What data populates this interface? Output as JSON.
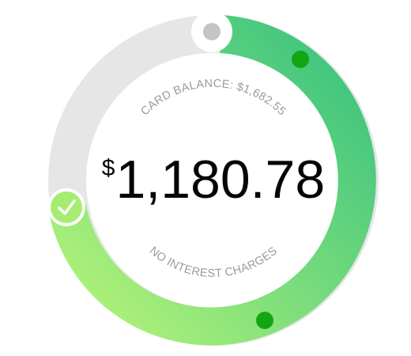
{
  "card_balance_label": "CARD BALANCE: $1,682.55",
  "amount": {
    "currency_symbol": "$",
    "value": "1,180.78"
  },
  "footer_label": "NO INTEREST CHARGES",
  "progress": {
    "payment_fraction": 0.702,
    "description_values": {
      "card_balance": 1682.55,
      "payment_amount": 1180.78
    }
  },
  "icons": {
    "min_handle": "check-icon",
    "max_handle": "gray-dot-icon",
    "markers": [
      "green-dot-icon",
      "green-dot-icon"
    ]
  },
  "colors": {
    "track": "#e6e6e6",
    "gradient_start": "#a9ef79",
    "gradient_end": "#3dc47f",
    "marker": "#14a514",
    "handle_gray": "#c4c4c4",
    "check_fill": "#a6ec72",
    "text_muted": "#9a9a9a"
  }
}
